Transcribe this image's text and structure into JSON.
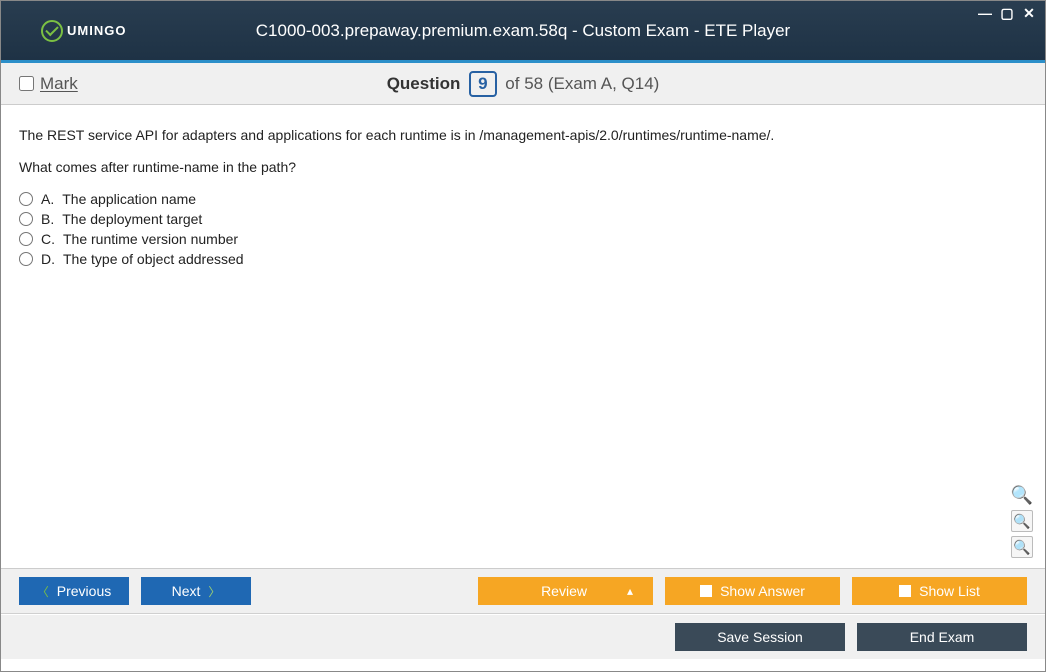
{
  "titlebar": {
    "brand": "UMINGO",
    "title": "C1000-003.prepaway.premium.exam.58q - Custom Exam - ETE Player"
  },
  "subheader": {
    "mark_label": "Mark",
    "question_label": "Question",
    "current": "9",
    "total_suffix": " of 58 (Exam A, Q14)"
  },
  "question": {
    "stem1": "The REST service API for adapters and applications for each runtime is in /management-apis/2.0/runtimes/runtime-name/.",
    "stem2": "What comes after runtime-name in the path?",
    "options": [
      {
        "letter": "A.",
        "text": "The application name"
      },
      {
        "letter": "B.",
        "text": "The deployment target"
      },
      {
        "letter": "C.",
        "text": "The runtime version number"
      },
      {
        "letter": "D.",
        "text": "The type of object addressed"
      }
    ]
  },
  "footer": {
    "previous": "Previous",
    "next": "Next",
    "review": "Review",
    "show_answer": "Show Answer",
    "show_list": "Show List",
    "save_session": "Save Session",
    "end_exam": "End Exam"
  }
}
